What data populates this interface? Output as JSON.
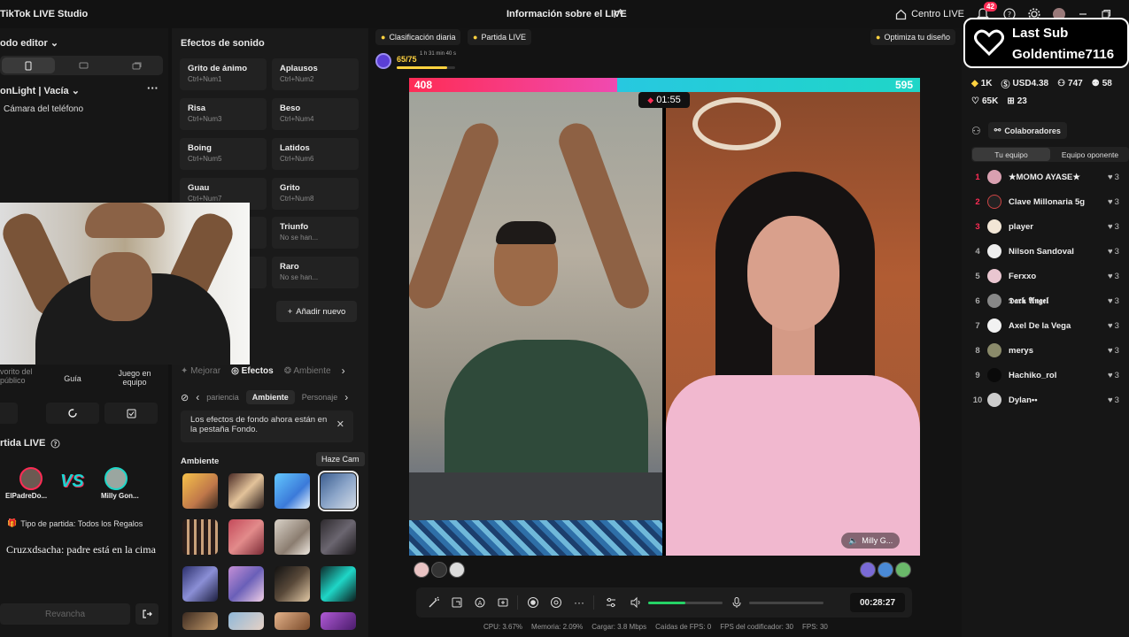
{
  "app": {
    "title": "TikTok LIVE Studio",
    "center_title": "Información sobre el LIVE",
    "centro_live": "Centro LIVE",
    "notifications": "42"
  },
  "left": {
    "mode": "odo editor",
    "scene": "onLight | Vacía",
    "scene_more": "···",
    "camera": "Cámara del teléfono",
    "tools": [
      {
        "label": "vorito del público"
      },
      {
        "label": "Guía"
      },
      {
        "label": "Juego en equipo"
      }
    ],
    "partida": "rtida LIVE",
    "player1": "ElPadreDo...",
    "player2": "Milly Gon...",
    "vs": "VS",
    "match_type": "Tipo de partida: Todos los Regalos",
    "chat": "Cruzxdsacha: padre está en la cima",
    "rematch": "Revancha"
  },
  "sfx": {
    "title": "Efectos de sonido",
    "items": [
      {
        "name": "Grito de ánimo",
        "key": "Ctrl+Num1"
      },
      {
        "name": "Aplausos",
        "key": "Ctrl+Num2"
      },
      {
        "name": "Risa",
        "key": "Ctrl+Num3"
      },
      {
        "name": "Beso",
        "key": "Ctrl+Num4"
      },
      {
        "name": "Boing",
        "key": "Ctrl+Num5"
      },
      {
        "name": "Latidos",
        "key": "Ctrl+Num6"
      },
      {
        "name": "Guau",
        "key": "Ctrl+Num7"
      },
      {
        "name": "Grito",
        "key": "Ctrl+Num8"
      },
      {
        "name": "",
        "key": ""
      },
      {
        "name": "Triunfo",
        "key": "No se han..."
      },
      {
        "name": "",
        "key": ""
      },
      {
        "name": "Raro",
        "key": "No se han..."
      }
    ],
    "add_new": "Añadir nuevo"
  },
  "effects": {
    "tabs": [
      "Mejorar",
      "Efectos",
      "Ambiente"
    ],
    "active_tab": "Efectos",
    "subtabs": [
      "pariencia",
      "Ambiente",
      "Personaje"
    ],
    "active_subtab": "Ambiente",
    "notice": "Los efectos de fondo ahora están en la pestaña Fondo.",
    "section": "Ambiente",
    "tooltip": "Haze Cam"
  },
  "stage": {
    "chip_daily": "Clasificación diaria",
    "chip_match": "Partida LIVE",
    "optimize": "Optimiza tu diseño",
    "level": "65/75",
    "level_timer": "1 h 31 min 40 s",
    "level_progress": 0.87,
    "score_left": "408",
    "score_right": "595",
    "score_left_share": 0.407,
    "battle_timer": "01:55",
    "right_name": "Milly G...",
    "elapsed": "00:28:27",
    "volume": 0.5,
    "stats": {
      "cpu": "CPU: 3.67%",
      "mem": "Memoria: 2.09%",
      "upload": "Cargar: 3.8 Mbps",
      "drops": "Caídas de FPS: 0",
      "encoder": "FPS del codificador: 30",
      "fps": "FPS: 30"
    }
  },
  "right": {
    "last_sub_title": "Last Sub",
    "last_sub_name": "Goldentime7116",
    "stats": {
      "diamonds": "1K",
      "usd": "USD4.38",
      "viewers": "747",
      "followers": "58",
      "likes": "65K",
      "gifts": "23"
    },
    "collab": "Colaboradores",
    "team_tabs": [
      "Tu equipo",
      "Equipo oponente"
    ],
    "ranking": [
      {
        "rank": "1",
        "name": "★MOMO AYASE★",
        "score": "3"
      },
      {
        "rank": "2",
        "name": "Clave Millonaria 5g",
        "score": "3"
      },
      {
        "rank": "3",
        "name": "player",
        "score": "3"
      },
      {
        "rank": "4",
        "name": "Nilson Sandoval",
        "score": "3"
      },
      {
        "rank": "5",
        "name": "Ferxxo",
        "score": "3"
      },
      {
        "rank": "6",
        "name": "𝕯𝖆𝖗𝖐 𝕬𝖓𝖌𝖊𝖑",
        "score": "3"
      },
      {
        "rank": "7",
        "name": "Axel De la Vega",
        "score": "3"
      },
      {
        "rank": "8",
        "name": "merys",
        "score": "3"
      },
      {
        "rank": "9",
        "name": "Hachiko_rol",
        "score": "3"
      },
      {
        "rank": "10",
        "name": "Dylan••",
        "score": "3"
      }
    ]
  },
  "colors": {
    "accent_pink": "#fe2c55",
    "accent_cyan": "#1fd6c7",
    "gold": "#ffd23f",
    "volume_green": "#25d366"
  }
}
